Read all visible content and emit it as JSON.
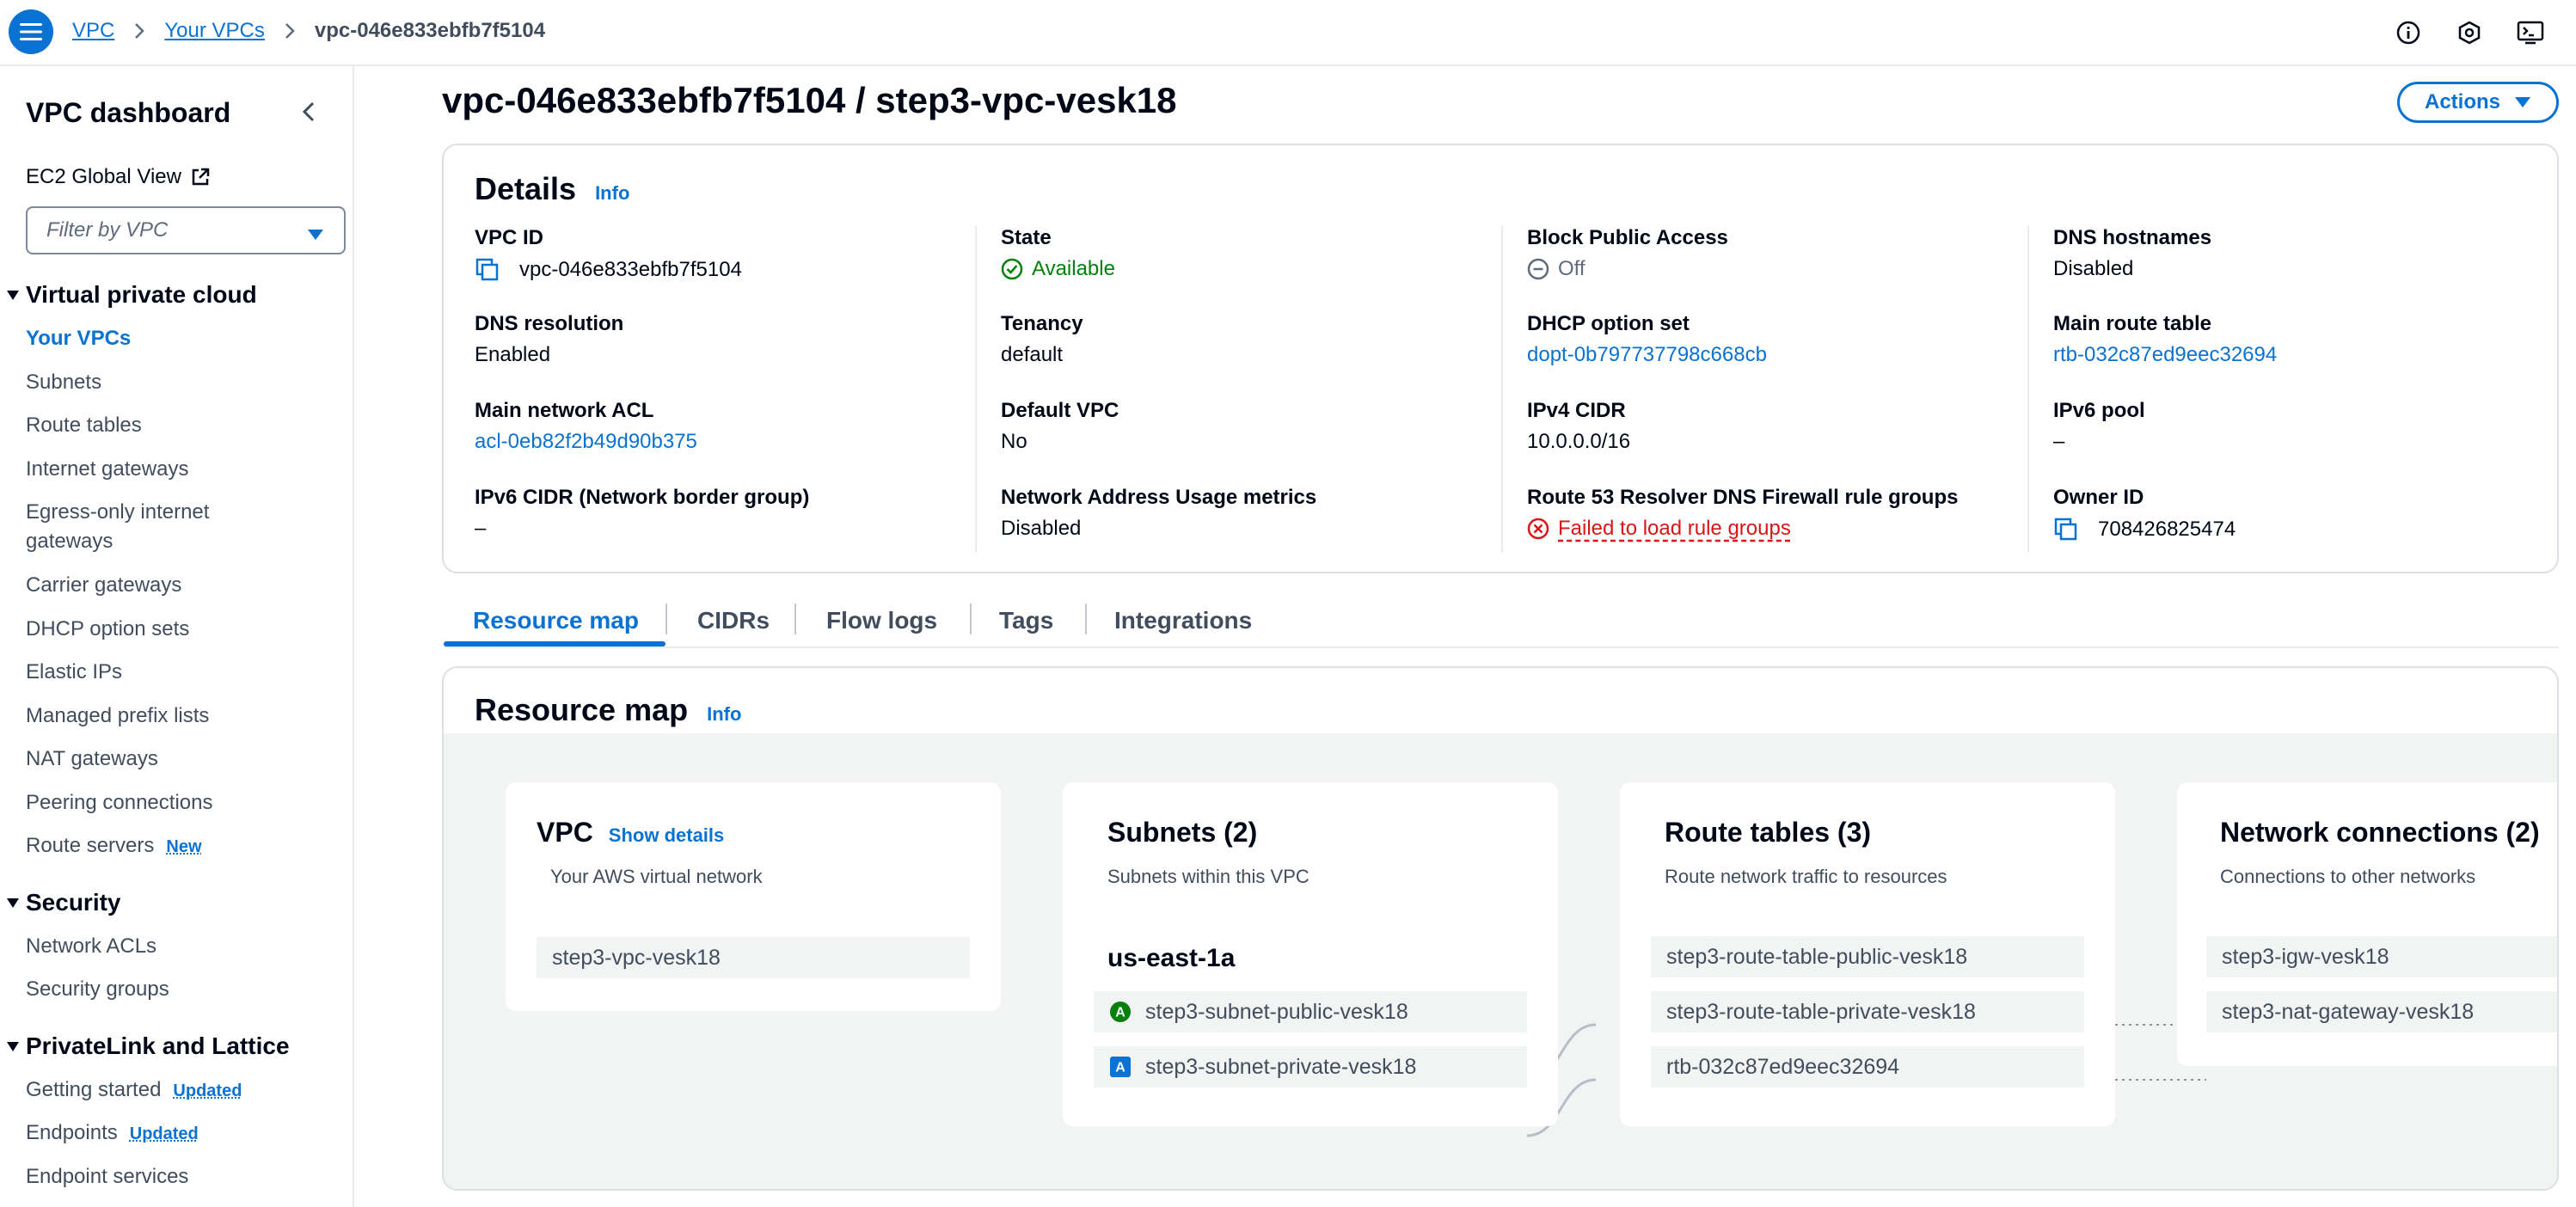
{
  "breadcrumb": {
    "items": [
      "VPC",
      "Your VPCs"
    ],
    "current": "vpc-046e833ebfb7f5104"
  },
  "icons": {
    "menu": "hamburger-icon",
    "info": "info-circle-icon",
    "notifications": "hexagon-icon",
    "cloudshell": "terminal-icon"
  },
  "sidebar": {
    "title": "VPC dashboard",
    "ec2_global_view": "EC2 Global View",
    "filter_placeholder": "Filter by VPC",
    "sections": [
      {
        "label": "Virtual private cloud",
        "items": [
          {
            "label": "Your VPCs",
            "active": true
          },
          {
            "label": "Subnets"
          },
          {
            "label": "Route tables"
          },
          {
            "label": "Internet gateways"
          },
          {
            "label": "Egress-only internet gateways"
          },
          {
            "label": "Carrier gateways"
          },
          {
            "label": "DHCP option sets"
          },
          {
            "label": "Elastic IPs"
          },
          {
            "label": "Managed prefix lists"
          },
          {
            "label": "NAT gateways"
          },
          {
            "label": "Peering connections"
          },
          {
            "label": "Route servers",
            "badge": "New"
          }
        ]
      },
      {
        "label": "Security",
        "items": [
          {
            "label": "Network ACLs"
          },
          {
            "label": "Security groups"
          }
        ]
      },
      {
        "label": "PrivateLink and Lattice",
        "items": [
          {
            "label": "Getting started",
            "badge": "Updated"
          },
          {
            "label": "Endpoints",
            "badge": "Updated"
          },
          {
            "label": "Endpoint services"
          }
        ]
      }
    ]
  },
  "page": {
    "title": "vpc-046e833ebfb7f5104 / step3-vpc-vesk18",
    "actions_label": "Actions"
  },
  "details": {
    "heading": "Details",
    "info": "Info",
    "columns": [
      [
        {
          "key": "VPC ID",
          "value": "vpc-046e833ebfb7f5104",
          "style": "copy"
        },
        {
          "key": "DNS resolution",
          "value": "Enabled"
        },
        {
          "key": "Main network ACL",
          "value": "acl-0eb82f2b49d90b375",
          "style": "link"
        },
        {
          "key": "IPv6 CIDR (Network border group)",
          "value": "–"
        }
      ],
      [
        {
          "key": "State",
          "value": "Available",
          "style": "green"
        },
        {
          "key": "Tenancy",
          "value": "default"
        },
        {
          "key": "Default VPC",
          "value": "No"
        },
        {
          "key": "Network Address Usage metrics",
          "value": "Disabled"
        }
      ],
      [
        {
          "key": "Block Public Access",
          "value": "Off",
          "style": "grey"
        },
        {
          "key": "DHCP option set",
          "value": "dopt-0b797737798c668cb",
          "style": "link"
        },
        {
          "key": "IPv4 CIDR",
          "value": "10.0.0.0/16"
        },
        {
          "key": "Route 53 Resolver DNS Firewall rule groups",
          "value": "Failed to load rule groups",
          "style": "red"
        }
      ],
      [
        {
          "key": "DNS hostnames",
          "value": "Disabled"
        },
        {
          "key": "Main route table",
          "value": "rtb-032c87ed9eec32694",
          "style": "link"
        },
        {
          "key": "IPv6 pool",
          "value": "–"
        },
        {
          "key": "Owner ID",
          "value": "708426825474",
          "style": "copy"
        }
      ]
    ]
  },
  "tabs": [
    "Resource map",
    "CIDRs",
    "Flow logs",
    "Tags",
    "Integrations"
  ],
  "resource_map": {
    "heading": "Resource map",
    "info": "Info",
    "vpc": {
      "title": "VPC",
      "show_details": "Show details",
      "desc": "Your AWS virtual network",
      "item": "step3-vpc-vesk18"
    },
    "subnets": {
      "title": "Subnets (2)",
      "desc": "Subnets within this VPC",
      "az": "us-east-1a",
      "items": [
        {
          "badge": "A",
          "color": "#037f0c",
          "label": "step3-subnet-public-vesk18"
        },
        {
          "badge": "A",
          "color": "#0972d3",
          "label": "step3-subnet-private-vesk18"
        }
      ]
    },
    "route_tables": {
      "title": "Route tables (3)",
      "desc": "Route network traffic to resources",
      "items": [
        "step3-route-table-public-vesk18",
        "step3-route-table-private-vesk18",
        "rtb-032c87ed9eec32694"
      ]
    },
    "network_connections": {
      "title": "Network connections (2)",
      "desc": "Connections to other networks",
      "items": [
        "step3-igw-vesk18",
        "step3-nat-gateway-vesk18"
      ]
    }
  }
}
